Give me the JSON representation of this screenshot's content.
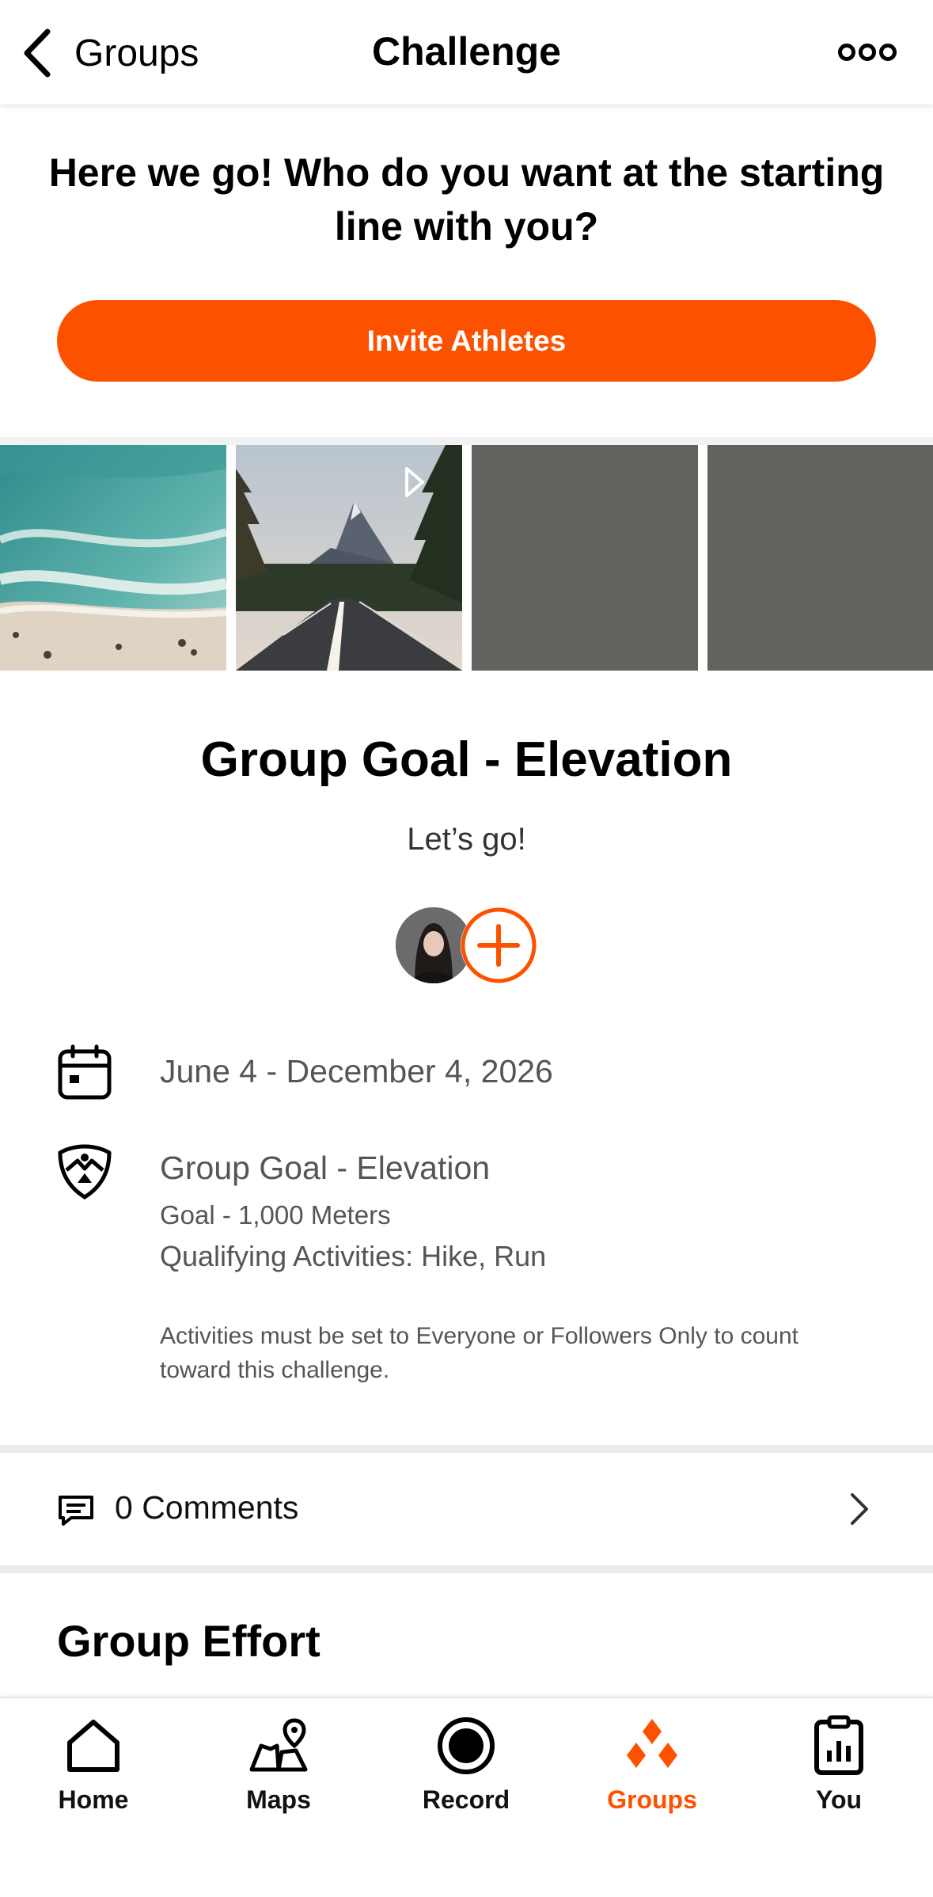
{
  "header": {
    "back_label": "Groups",
    "title": "Challenge",
    "more_icon": "more-dots-icon"
  },
  "invite": {
    "prompt": "Here we go! Who do you want at the starting line with you?",
    "button_label": "Invite Athletes",
    "accent": "#fc5200"
  },
  "challenge": {
    "title": "Group Goal - Elevation",
    "subtitle": "Let’s go!",
    "dates": "June 4 - December 4, 2026",
    "goal_type": "Group Goal - Elevation",
    "goal": "Goal - 1,000 Meters",
    "qualifying": "Qualifying Activities: Hike, Run",
    "note": "Activities must be set to Everyone or Followers Only to count toward this challenge."
  },
  "comments": {
    "label": "0 Comments"
  },
  "section": {
    "group_effort": "Group Effort"
  },
  "tabs": [
    {
      "label": "Home",
      "icon": "home-icon",
      "active": false
    },
    {
      "label": "Maps",
      "icon": "maps-icon",
      "active": false
    },
    {
      "label": "Record",
      "icon": "record-icon",
      "active": false
    },
    {
      "label": "Groups",
      "icon": "groups-icon",
      "active": true
    },
    {
      "label": "You",
      "icon": "you-icon",
      "active": false
    }
  ]
}
